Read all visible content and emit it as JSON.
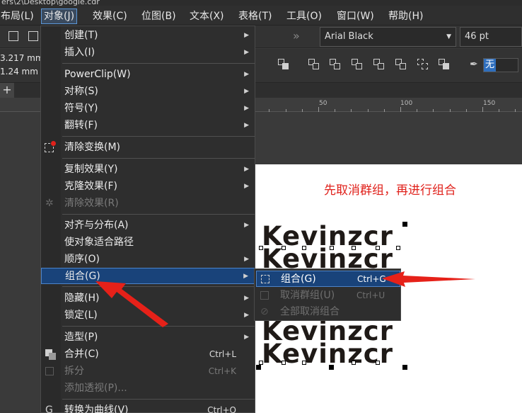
{
  "window": {
    "path_fragment": "ers\\2\\Desktop\\google.cdr"
  },
  "menubar": {
    "items": [
      {
        "label": "布局(L)"
      },
      {
        "label": "对象(J)"
      },
      {
        "label": "效果(C)"
      },
      {
        "label": "位图(B)"
      },
      {
        "label": "文本(X)"
      },
      {
        "label": "表格(T)"
      },
      {
        "label": "工具(O)"
      },
      {
        "label": "窗口(W)"
      },
      {
        "label": "帮助(H)"
      }
    ]
  },
  "propbar": {
    "font_name": "Arial Black",
    "font_size": "46 pt",
    "x_value": "3.217 mm",
    "y_value": "1.24 mm",
    "outline_value": "无"
  },
  "ruler": {
    "labels": [
      "50",
      "100",
      "150"
    ]
  },
  "object_menu": {
    "items": [
      {
        "label": "创建(T)",
        "submenu": true
      },
      {
        "label": "插入(I)",
        "submenu": true
      },
      {
        "label": "PowerClip(W)",
        "submenu": true
      },
      {
        "label": "对称(S)",
        "submenu": true
      },
      {
        "label": "符号(Y)",
        "submenu": true
      },
      {
        "label": "翻转(F)",
        "submenu": true
      },
      {
        "label": "清除变换(M)"
      },
      {
        "label": "复制效果(Y)",
        "submenu": true
      },
      {
        "label": "克隆效果(F)",
        "submenu": true
      },
      {
        "label": "清除效果(R)",
        "disabled": true
      },
      {
        "label": "对齐与分布(A)",
        "submenu": true
      },
      {
        "label": "使对象适合路径"
      },
      {
        "label": "顺序(O)",
        "submenu": true
      },
      {
        "label": "组合(G)",
        "submenu": true,
        "selected": true
      },
      {
        "label": "隐藏(H)",
        "submenu": true
      },
      {
        "label": "锁定(L)",
        "submenu": true
      },
      {
        "label": "造型(P)",
        "submenu": true
      },
      {
        "label": "合并(C)",
        "shortcut": "Ctrl+L"
      },
      {
        "label": "拆分",
        "shortcut": "Ctrl+K",
        "disabled": true
      },
      {
        "label": "添加透视(P)...",
        "disabled": true
      },
      {
        "label": "转换为曲线(V)",
        "shortcut": "Ctrl+Q"
      }
    ]
  },
  "group_submenu": {
    "items": [
      {
        "label": "组合(G)",
        "shortcut": "Ctrl+G",
        "selected": true
      },
      {
        "label": "取消群组(U)",
        "shortcut": "Ctrl+U",
        "disabled": true
      },
      {
        "label": "全部取消组合",
        "disabled": true
      }
    ]
  },
  "canvas": {
    "annotation": "先取消群组，再进行组合",
    "text_lines": [
      "Kevinzcr",
      "Kevinzcr",
      "Kevinzcr",
      "Kevinzcr"
    ],
    "annotation_color": "#e0211b"
  }
}
